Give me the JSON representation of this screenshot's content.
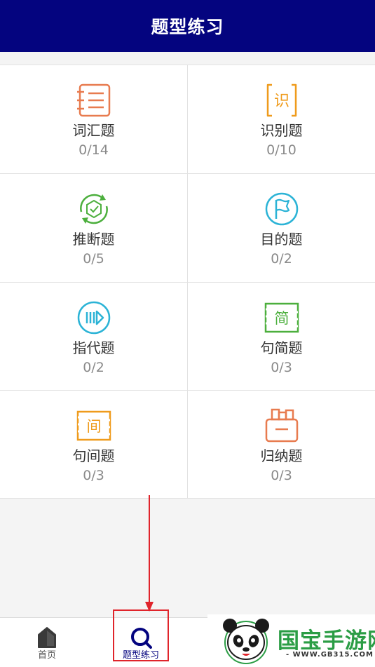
{
  "header": {
    "title": "题型练习"
  },
  "question_types": [
    {
      "name": "词汇题",
      "count": "0/14",
      "icon": "vocabulary-list-icon",
      "color": "#e87b4f"
    },
    {
      "name": "识别题",
      "count": "0/10",
      "icon": "recognition-icon",
      "color": "#ef9b1c"
    },
    {
      "name": "推断题",
      "count": "0/5",
      "icon": "inference-cycle-icon",
      "color": "#4caf3d"
    },
    {
      "name": "目的题",
      "count": "0/2",
      "icon": "purpose-flag-icon",
      "color": "#2bb3d6"
    },
    {
      "name": "指代题",
      "count": "0/2",
      "icon": "reference-play-icon",
      "color": "#2bb3d6"
    },
    {
      "name": "句简题",
      "count": "0/3",
      "icon": "sentence-simplify-icon",
      "color": "#4caf3d"
    },
    {
      "name": "句间题",
      "count": "0/3",
      "icon": "sentence-between-icon",
      "color": "#ef9b1c"
    },
    {
      "name": "归纳题",
      "count": "0/3",
      "icon": "summary-box-icon",
      "color": "#e87b4f"
    }
  ],
  "icon_glyphs": {
    "recognition": "识",
    "simplify": "简",
    "between": "间"
  },
  "tabbar": {
    "home_label": "首页",
    "practice_label": "题型练习",
    "active_color": "#04047f"
  },
  "watermark": {
    "title": "国宝手游网",
    "url": "- WWW.GB315.COM -"
  },
  "colors": {
    "header_bg": "#04047f",
    "annotation_red": "#e0242b"
  }
}
